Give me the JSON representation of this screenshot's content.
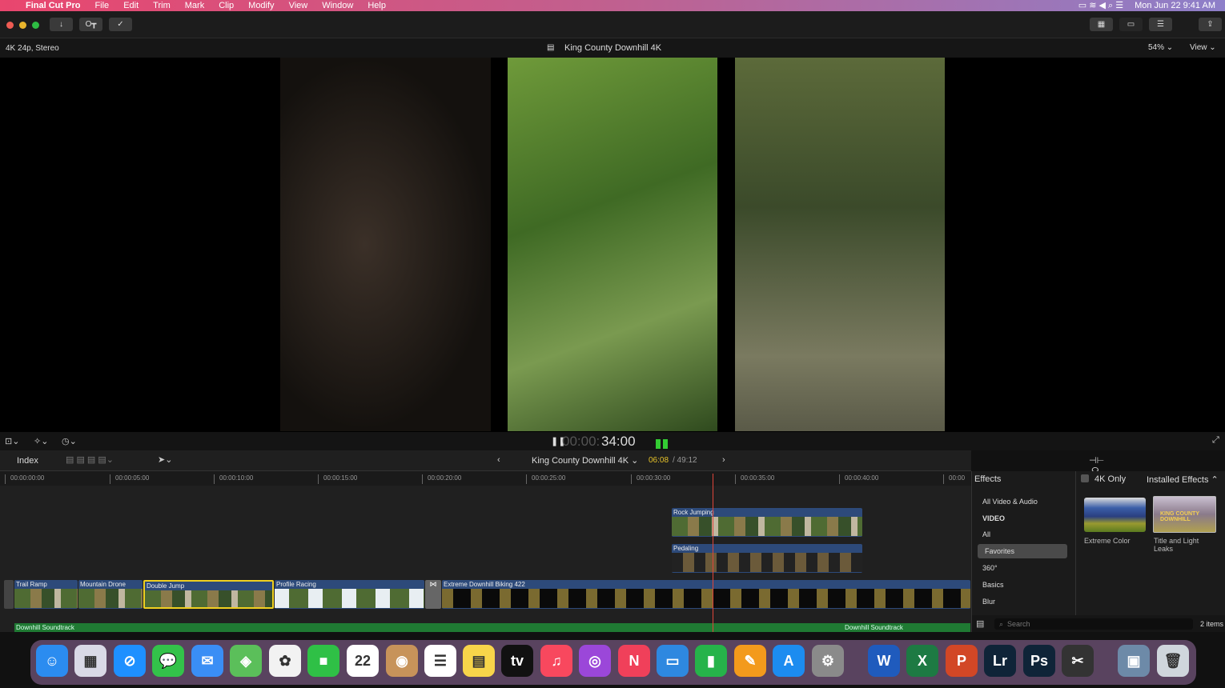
{
  "menubar": {
    "app": "Final Cut Pro",
    "items": [
      "File",
      "Edit",
      "Trim",
      "Mark",
      "Clip",
      "Modify",
      "View",
      "Window",
      "Help"
    ],
    "clock": "Mon Jun 22  9:41 AM"
  },
  "viewer": {
    "format": "4K 24p, Stereo",
    "title": "King County Downhill 4K",
    "zoom": "54%",
    "view": "View",
    "timecode_dim": "00:00:",
    "timecode": "34:00"
  },
  "timeline": {
    "index": "Index",
    "project": "King County Downhill 4K",
    "position": "06:08",
    "duration": "/ 49:12",
    "ruler": [
      "00:00:00:00",
      "00:00:05:00",
      "00:00:10:00",
      "00:00:15:00",
      "00:00:20:00",
      "00:00:25:00",
      "00:00:30:00",
      "00:00:35:00",
      "00:00:40:00",
      "00:00"
    ],
    "connected": [
      "Rock Jumping",
      "Pedaling"
    ],
    "clips": [
      "Trail Ramp",
      "Mountain Drone",
      "Double Jump",
      "Profile Racing",
      "Extreme Downhill Biking 422"
    ],
    "audio": [
      "Downhill Soundtrack",
      "Downhill Soundtrack"
    ]
  },
  "effects": {
    "title": "Effects",
    "only4k": "4K Only",
    "source": "Installed Effects ⌃",
    "categories": [
      "All Video & Audio",
      "VIDEO",
      "All",
      "Favorites",
      "360°",
      "Basics",
      "Blur"
    ],
    "items": [
      "Extreme Color",
      "Title and Light Leaks"
    ],
    "thumb_text": "KING COUNTY DOWNHILL",
    "search_placeholder": "Search",
    "count": "2 items"
  },
  "dock": [
    {
      "name": "finder",
      "g": "☺",
      "c": "#2b8cf0"
    },
    {
      "name": "launchpad",
      "g": "▦",
      "c": "#d9d9e6"
    },
    {
      "name": "safari",
      "g": "⊘",
      "c": "#1e90ff"
    },
    {
      "name": "messages",
      "g": "💬",
      "c": "#33c24a"
    },
    {
      "name": "mail",
      "g": "✉",
      "c": "#3a8ef5"
    },
    {
      "name": "maps",
      "g": "◈",
      "c": "#5bbf5a"
    },
    {
      "name": "photos",
      "g": "✿",
      "c": "#f2f2f2"
    },
    {
      "name": "facetime",
      "g": "■",
      "c": "#2fc046"
    },
    {
      "name": "calendar",
      "g": "22",
      "c": "#ffffff"
    },
    {
      "name": "contacts",
      "g": "◉",
      "c": "#c7935a"
    },
    {
      "name": "reminders",
      "g": "☰",
      "c": "#ffffff"
    },
    {
      "name": "notes",
      "g": "▤",
      "c": "#f7d54a"
    },
    {
      "name": "tv",
      "g": "tv",
      "c": "#111111"
    },
    {
      "name": "music",
      "g": "♫",
      "c": "#f8485e"
    },
    {
      "name": "podcasts",
      "g": "◎",
      "c": "#9b47d9"
    },
    {
      "name": "news",
      "g": "N",
      "c": "#f0405a"
    },
    {
      "name": "keynote",
      "g": "▭",
      "c": "#2e88e0"
    },
    {
      "name": "numbers",
      "g": "▮",
      "c": "#26b34a"
    },
    {
      "name": "pages",
      "g": "✎",
      "c": "#f39a1c"
    },
    {
      "name": "app-store",
      "g": "A",
      "c": "#1c8cf0"
    },
    {
      "name": "system-preferences",
      "g": "⚙",
      "c": "#8a8a8a"
    },
    {
      "name": "word",
      "g": "W",
      "c": "#1f5bbd"
    },
    {
      "name": "excel",
      "g": "X",
      "c": "#1d7a43"
    },
    {
      "name": "powerpoint",
      "g": "P",
      "c": "#d24726"
    },
    {
      "name": "lightroom",
      "g": "Lr",
      "c": "#0f2438"
    },
    {
      "name": "photoshop",
      "g": "Ps",
      "c": "#0f2438"
    },
    {
      "name": "final-cut-pro",
      "g": "✂",
      "c": "#333333"
    },
    {
      "name": "preview",
      "g": "▣",
      "c": "#6d8aa8"
    },
    {
      "name": "trash",
      "g": "🗑",
      "c": "#cfd6dc"
    }
  ]
}
